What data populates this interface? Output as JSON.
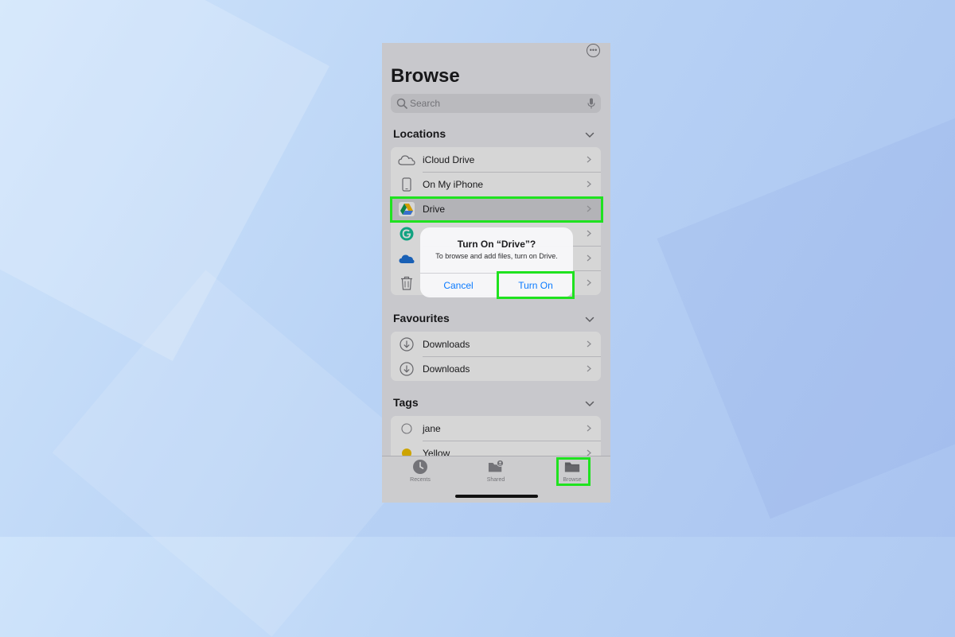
{
  "header": {
    "title": "Browse",
    "more_icon": "ellipsis-circle-icon"
  },
  "search": {
    "placeholder": "Search"
  },
  "locations": {
    "title": "Locations",
    "items": [
      {
        "label": "iCloud Drive",
        "icon": "cloud-icon"
      },
      {
        "label": "On My iPhone",
        "icon": "iphone-icon"
      },
      {
        "label": "Drive",
        "icon": "google-drive-icon",
        "selected": true
      },
      {
        "label": "",
        "icon": "grammarly-icon"
      },
      {
        "label": "",
        "icon": "onedrive-icon"
      },
      {
        "label": "",
        "icon": "trash-icon"
      }
    ]
  },
  "favourites": {
    "title": "Favourites",
    "items": [
      {
        "label": "Downloads",
        "icon": "download-circle-icon"
      },
      {
        "label": "Downloads",
        "icon": "download-circle-icon"
      }
    ]
  },
  "tags": {
    "title": "Tags",
    "items": [
      {
        "label": "jane",
        "color": "#ffffff"
      },
      {
        "label": "Yellow",
        "color": "#f5c400"
      }
    ]
  },
  "dialog": {
    "title": "Turn On “Drive”?",
    "message": "To browse and add files, turn on Drive.",
    "cancel": "Cancel",
    "confirm": "Turn On"
  },
  "tabbar": {
    "tabs": [
      {
        "label": "Recents",
        "icon": "clock-icon"
      },
      {
        "label": "Shared",
        "icon": "shared-folder-icon"
      },
      {
        "label": "Browse",
        "icon": "folder-icon",
        "selected": true
      }
    ]
  },
  "colors": {
    "accent": "#0a7aff",
    "highlight": "#1fe21f",
    "background": "#b9d3f5"
  }
}
